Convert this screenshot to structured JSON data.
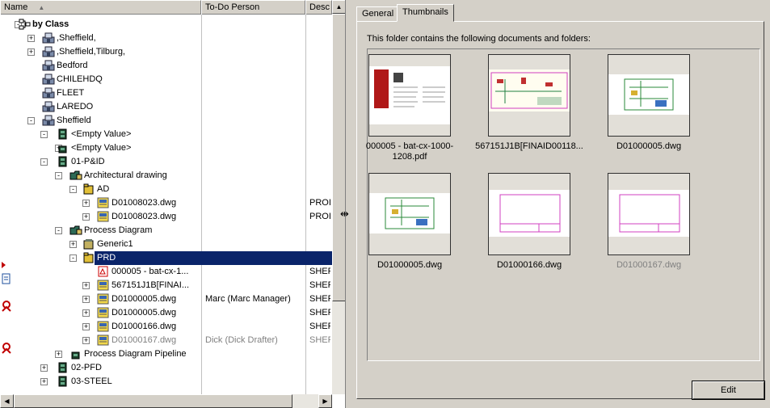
{
  "columns": {
    "name": "Name",
    "person": "To-Do Person",
    "desc": "Desc"
  },
  "tree": [
    {
      "label": "by Class",
      "bold": true
    },
    {
      "label": ",Sheffield,"
    },
    {
      "label": ",Sheffield,Tilburg,"
    },
    {
      "label": "Bedford"
    },
    {
      "label": "CHILEHDQ"
    },
    {
      "label": "FLEET"
    },
    {
      "label": "LAREDO"
    },
    {
      "label": "Sheffield"
    },
    {
      "label": "<Empty Value>"
    },
    {
      "label": "<Empty Value>"
    },
    {
      "label": "01-P&ID"
    },
    {
      "label": "Architectural drawing"
    },
    {
      "label": "AD"
    },
    {
      "label": "D01008023.dwg",
      "desc": "PROI"
    },
    {
      "label": "D01008023.dwg",
      "desc": "PROI"
    },
    {
      "label": "Process Diagram"
    },
    {
      "label": "Generic1"
    },
    {
      "label": "PRD",
      "selected": true
    },
    {
      "label": "000005 - bat-cx-1...",
      "desc": "SHEF"
    },
    {
      "label": "567151J1B[FINAI...",
      "desc": "SHEF"
    },
    {
      "label": "D01000005.dwg",
      "person": "Marc (Marc Manager)",
      "desc": "SHEF"
    },
    {
      "label": "D01000005.dwg",
      "desc": "SHEF"
    },
    {
      "label": "D01000166.dwg",
      "desc": "SHEF"
    },
    {
      "label": "D01000167.dwg",
      "person": "Dick (Dick Drafter)",
      "desc": "SHEF",
      "grey": true
    },
    {
      "label": "Process Diagram Pipeline"
    },
    {
      "label": "02-PFD"
    },
    {
      "label": "03-STEEL"
    }
  ],
  "tabs": {
    "general": "General",
    "thumbnails": "Thumbnails"
  },
  "info_text": "This folder contains the following documents and folders:",
  "thumbnails": [
    {
      "caption": "000005 - bat-cx-1000-1208.pdf",
      "kind": "pdf"
    },
    {
      "caption": "567151J1B[FINAID00118...",
      "kind": "dwg-wide"
    },
    {
      "caption": "D01000005.dwg",
      "kind": "dwg-green"
    },
    {
      "caption": "D01000005.dwg",
      "kind": "dwg-green"
    },
    {
      "caption": "D01000166.dwg",
      "kind": "dwg-pink"
    },
    {
      "caption": "D01000167.dwg",
      "kind": "dwg-pink",
      "grey": true
    }
  ],
  "edit_label": "Edit",
  "icons": {
    "sort": "sort-ascending-icon",
    "expand": "expand-plus-icon",
    "collapse": "collapse-minus-icon"
  },
  "colors": {
    "selection": "#0a246a",
    "panel": "#d4d0c8"
  }
}
